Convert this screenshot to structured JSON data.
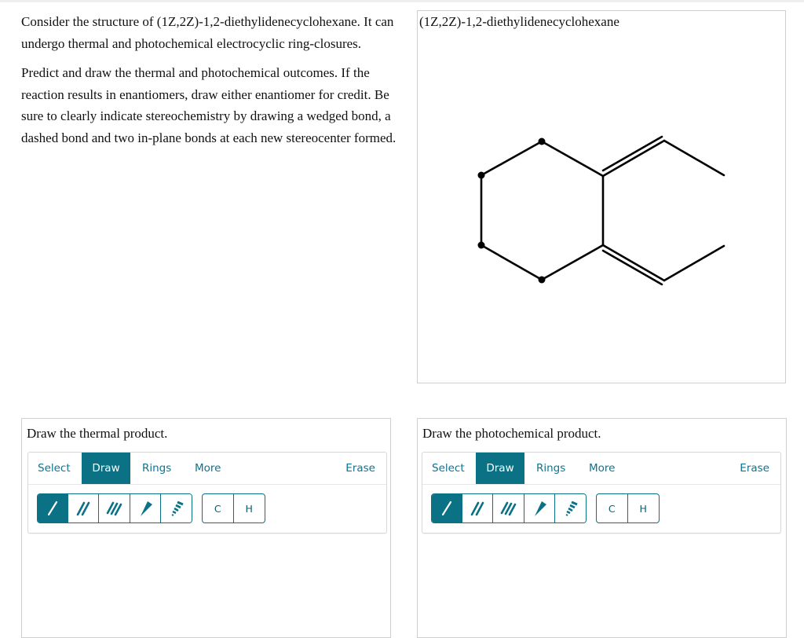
{
  "question": {
    "paragraph1": "Consider the structure of (1Z,2Z)-1,2-diethylidenecyclohexane. It can undergo thermal and photochemical electrocyclic ring-closures.",
    "paragraph2": "Predict and draw the thermal and photochemical outcomes. If the reaction results in enantiomers, draw either enantiomer for credit. Be sure to clearly indicate stereochemistry by drawing a wedged bond, a dashed bond and two in-plane bonds at each new stereocenter formed."
  },
  "molecule": {
    "name": "(1Z,2Z)-1,2-diethylidenecyclohexane",
    "structure": "cyclohexane ring with two exocyclic ethylidene double bonds at adjacent carbons"
  },
  "panels": [
    {
      "id": "thermal",
      "title": "Draw the thermal product.",
      "tabs": [
        {
          "label": "Select",
          "active": false
        },
        {
          "label": "Draw",
          "active": true
        },
        {
          "label": "Rings",
          "active": false
        },
        {
          "label": "More",
          "active": false
        }
      ],
      "erase_label": "Erase",
      "bond_tools": [
        {
          "name": "single-bond",
          "active": true
        },
        {
          "name": "double-bond",
          "active": false
        },
        {
          "name": "triple-bond",
          "active": false
        },
        {
          "name": "wedge-bond",
          "active": false
        },
        {
          "name": "dash-bond",
          "active": false
        }
      ],
      "atom_tools": [
        "C",
        "H"
      ]
    },
    {
      "id": "photochemical",
      "title": "Draw the photochemical product.",
      "tabs": [
        {
          "label": "Select",
          "active": false
        },
        {
          "label": "Draw",
          "active": true
        },
        {
          "label": "Rings",
          "active": false
        },
        {
          "label": "More",
          "active": false
        }
      ],
      "erase_label": "Erase",
      "bond_tools": [
        {
          "name": "single-bond",
          "active": true
        },
        {
          "name": "double-bond",
          "active": false
        },
        {
          "name": "triple-bond",
          "active": false
        },
        {
          "name": "wedge-bond",
          "active": false
        },
        {
          "name": "dash-bond",
          "active": false
        }
      ],
      "atom_tools": [
        "C",
        "H"
      ]
    }
  ],
  "colors": {
    "accent": "#0b7285",
    "accent_text": "#0e7490",
    "border": "#cfcfcf"
  }
}
